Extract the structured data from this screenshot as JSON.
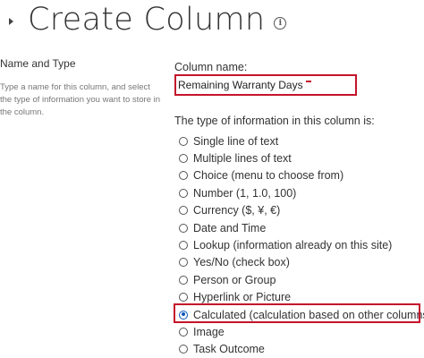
{
  "header": {
    "title": "Create Column",
    "info_icon_glyph": "i",
    "caret_icon": "caret-right-icon"
  },
  "section": {
    "heading": "Name and Type",
    "description": "Type a name for this column, and select the type of information you want to store in the column."
  },
  "column_name": {
    "label": "Column name:",
    "value": "Remaining Warranty Days"
  },
  "type_section": {
    "label": "The type of information in this column is:",
    "options": [
      {
        "label": "Single line of text",
        "checked": false
      },
      {
        "label": "Multiple lines of text",
        "checked": false
      },
      {
        "label": "Choice (menu to choose from)",
        "checked": false
      },
      {
        "label": "Number (1, 1.0, 100)",
        "checked": false
      },
      {
        "label": "Currency ($, ¥, €)",
        "checked": false
      },
      {
        "label": "Date and Time",
        "checked": false
      },
      {
        "label": "Lookup (information already on this site)",
        "checked": false
      },
      {
        "label": "Yes/No (check box)",
        "checked": false
      },
      {
        "label": "Person or Group",
        "checked": false
      },
      {
        "label": "Hyperlink or Picture",
        "checked": false
      },
      {
        "label": "Calculated (calculation based on other columns)",
        "checked": true
      },
      {
        "label": "Image",
        "checked": false
      },
      {
        "label": "Task Outcome",
        "checked": false
      }
    ]
  },
  "colors": {
    "highlight": "#c4142b",
    "radio_selected": "#0a58b8"
  }
}
